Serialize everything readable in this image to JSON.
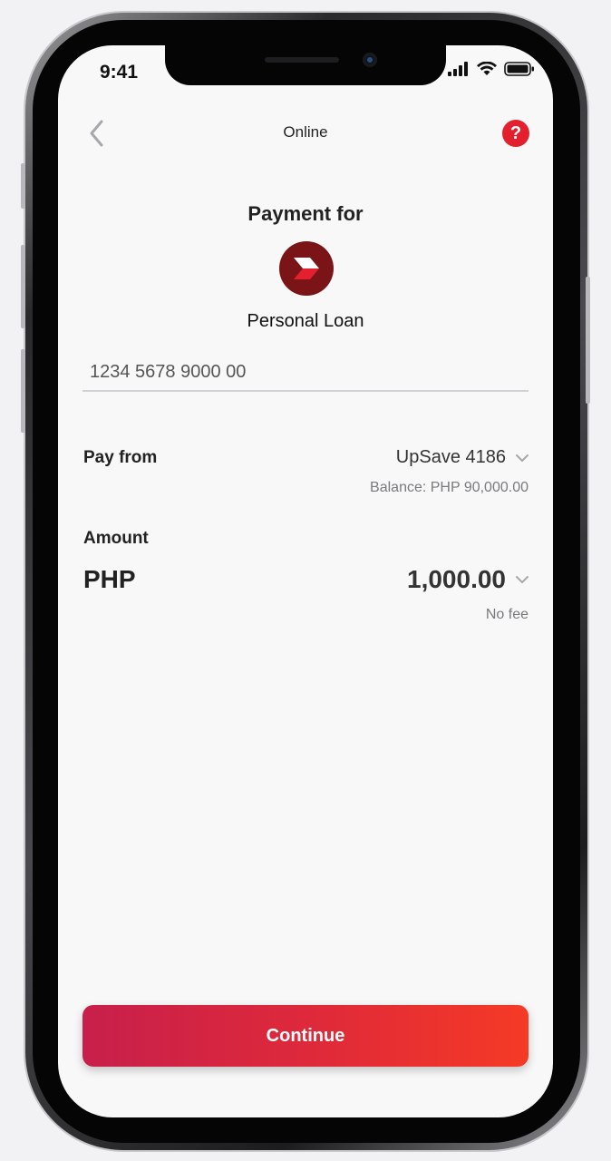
{
  "status_bar": {
    "time": "9:41",
    "icons": [
      "signal-icon",
      "wifi-icon",
      "battery-icon"
    ]
  },
  "header": {
    "back_icon": "chevron-left-icon",
    "title": "Online",
    "help_label": "?"
  },
  "payment": {
    "title": "Payment for",
    "biller_logo": "biller-logo-icon",
    "biller_name": "Personal Loan",
    "account_number": "1234 5678 9000 00"
  },
  "pay_from": {
    "label": "Pay from",
    "account": "UpSave 4186",
    "balance": "Balance: PHP 90,000.00"
  },
  "amount": {
    "label": "Amount",
    "currency": "PHP",
    "value": "1,000.00",
    "fee": "No fee"
  },
  "footer": {
    "continue_label": "Continue"
  },
  "colors": {
    "accent": "#e3202e",
    "button_gradient_start": "#c71f4b",
    "button_gradient_end": "#f53a25",
    "logo_background": "#7a1416"
  }
}
